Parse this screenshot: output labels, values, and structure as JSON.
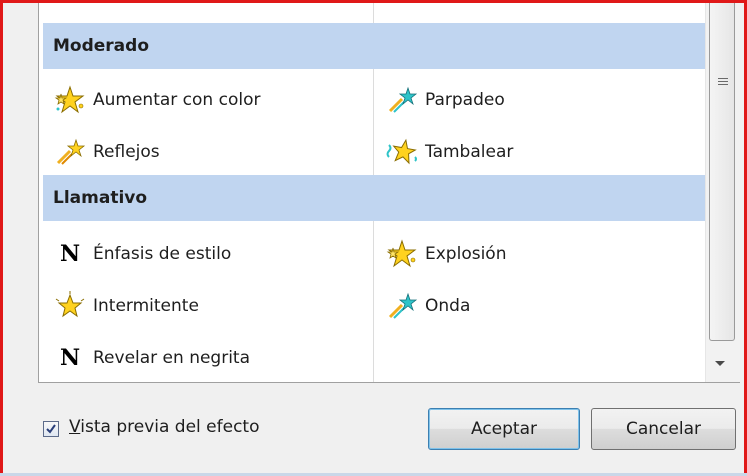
{
  "categories": [
    {
      "label": "Moderado",
      "items": [
        {
          "label": "Aumentar con color",
          "icon": "star-burst-color-icon",
          "col": 0
        },
        {
          "label": "Parpadeo",
          "icon": "shooting-star-icon",
          "col": 1
        },
        {
          "label": "Reflejos",
          "icon": "shooting-star-icon",
          "col": 0
        },
        {
          "label": "Tambalear",
          "icon": "wobble-star-icon",
          "col": 1
        }
      ]
    },
    {
      "label": "Llamativo",
      "items": [
        {
          "label": "Énfasis de estilo",
          "icon": "bold-n-icon",
          "col": 0
        },
        {
          "label": "Explosión",
          "icon": "star-burst-color-icon",
          "col": 1
        },
        {
          "label": "Intermitente",
          "icon": "blink-star-icon",
          "col": 0
        },
        {
          "label": "Onda",
          "icon": "shooting-star-icon",
          "col": 1
        },
        {
          "label": "Revelar en negrita",
          "icon": "bold-n-icon",
          "col": 0
        }
      ]
    }
  ],
  "preview_checkbox": {
    "label_first": "V",
    "label_rest": "ista previa del efecto",
    "checked": true
  },
  "buttons": {
    "ok": "Aceptar",
    "cancel": "Cancelar"
  },
  "colors": {
    "category_bg": "#c0d5f0",
    "frame_border": "#e01818",
    "star_yellow": "#ffd21f",
    "star_teal": "#2ec4c9"
  }
}
